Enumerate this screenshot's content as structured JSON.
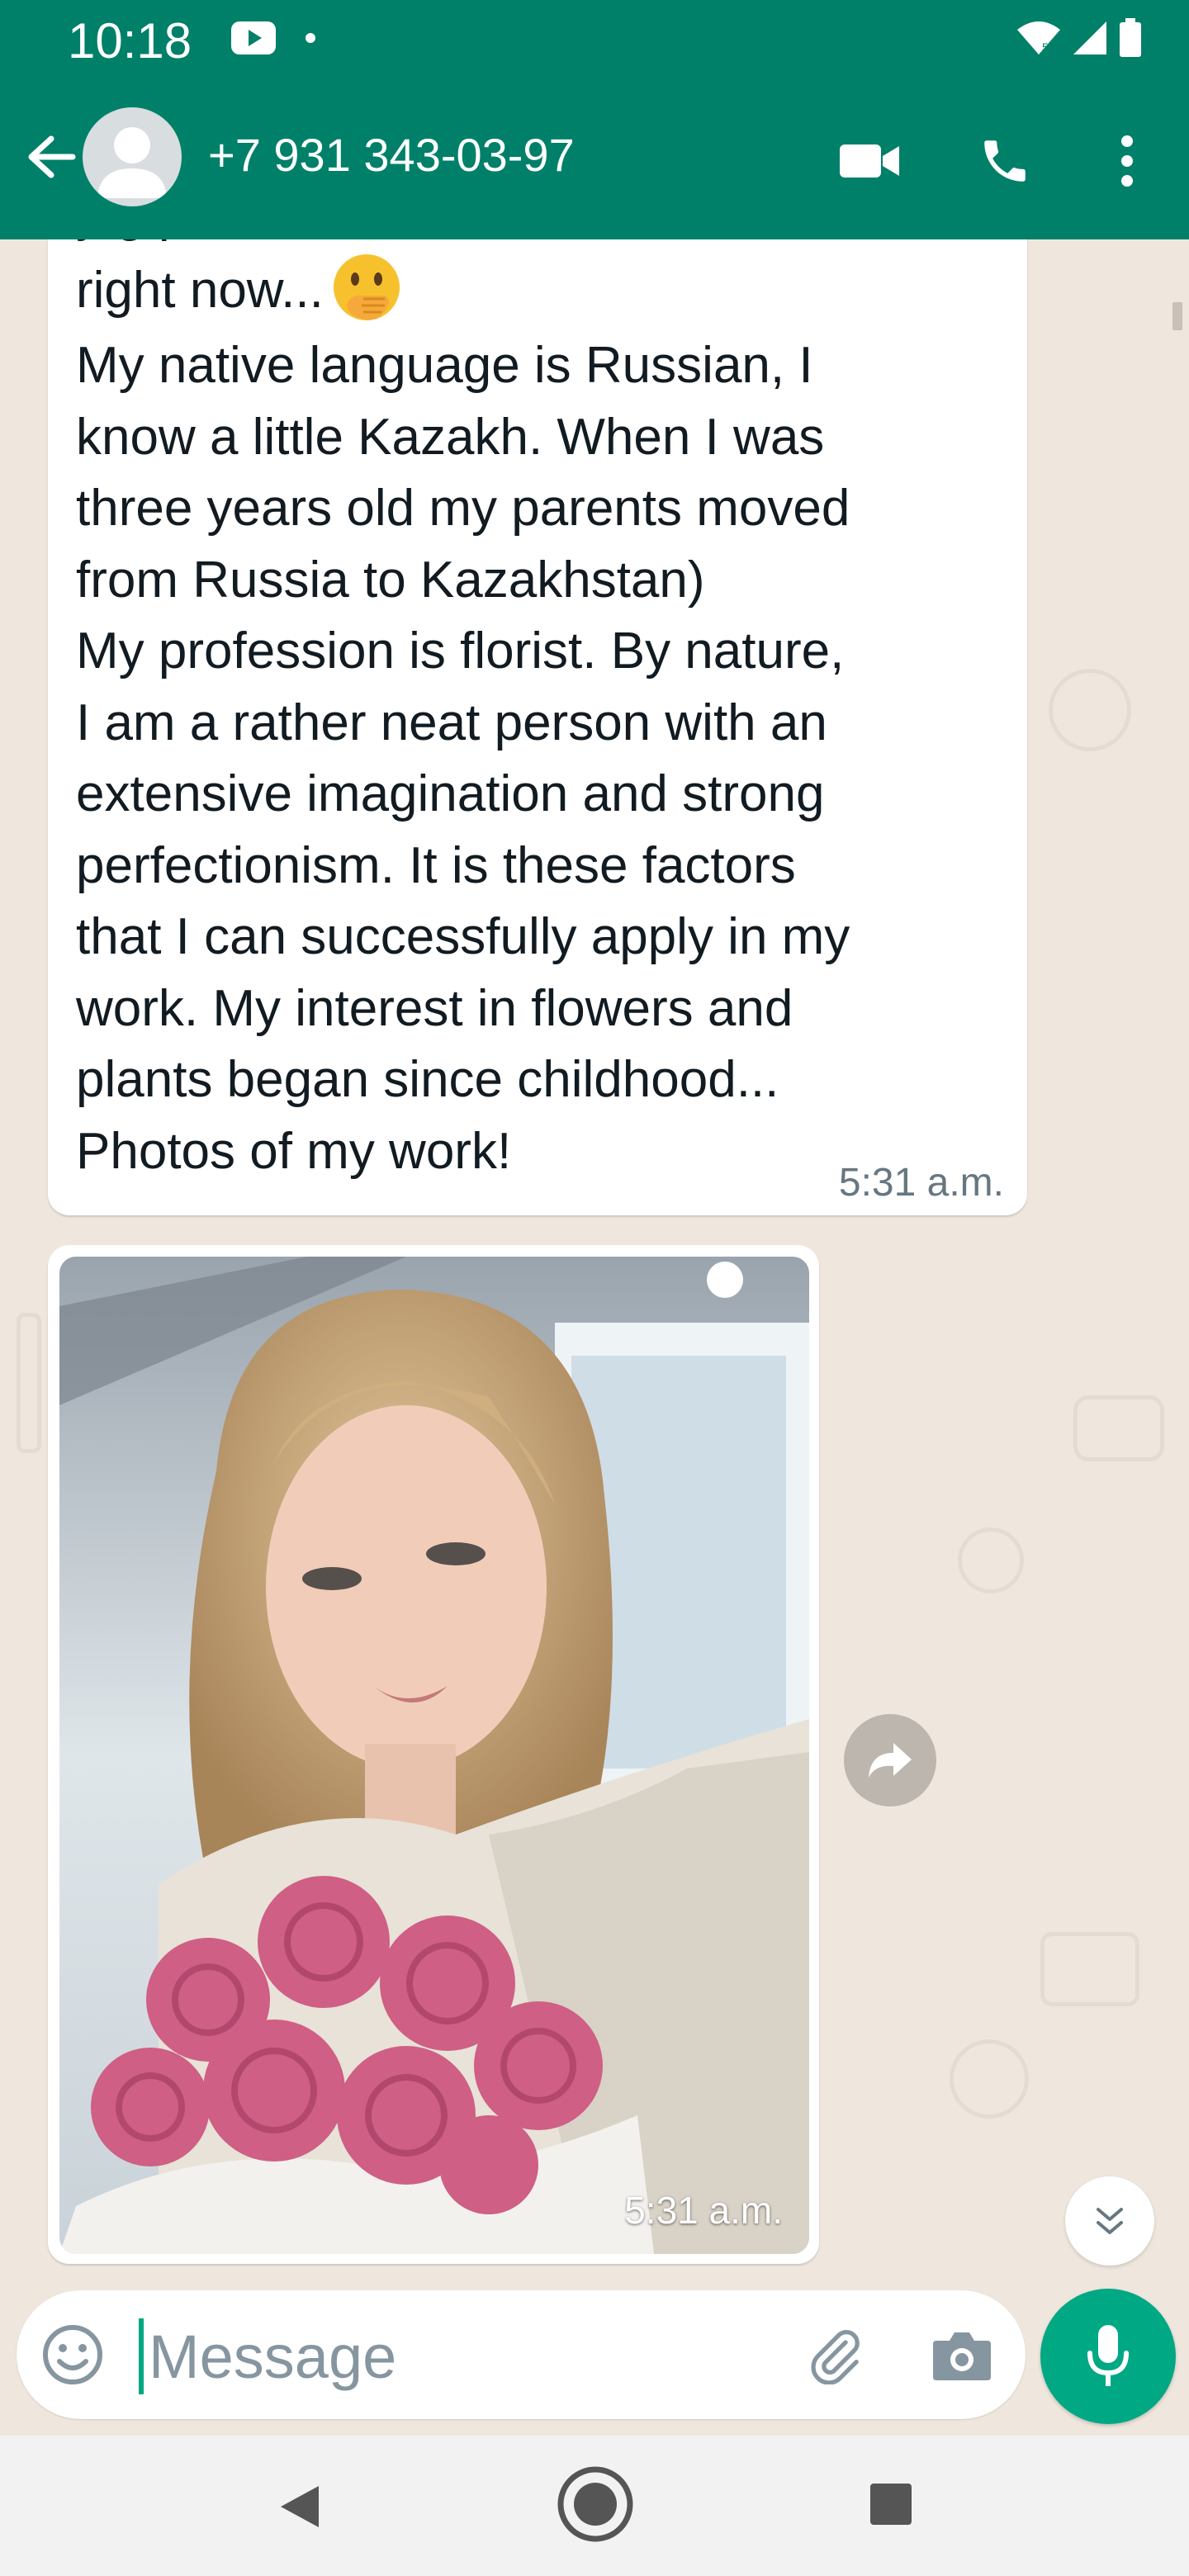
{
  "status_bar": {
    "time": "10:18"
  },
  "header": {
    "contact_name": "+7 931 343-03-97",
    "icons": [
      "back-arrow-icon",
      "avatar",
      "video-call-icon",
      "phone-icon",
      "more-vertical-icon"
    ]
  },
  "messages": [
    {
      "type": "text",
      "partial_top_line": "y          g          p",
      "text_first_line": "right now...",
      "emoji": "face-with-hand-over-mouth",
      "text_rest": "My native language is Russian, I\nknow a little Kazakh. When I was\nthree years old my parents moved\nfrom Russia to Kazakhstan)\nMy profession is florist. By nature,\nI am a rather neat person with an\nextensive imagination and strong\nperfectionism. It is these factors\nthat I can successfully apply in my\nwork. My interest in flowers and\nplants began since childhood...\nPhotos of my work!",
      "time": "5:31 a.m."
    },
    {
      "type": "image",
      "time": "5:31 a.m."
    }
  ],
  "input": {
    "placeholder": "Message"
  },
  "colors": {
    "header": "#008069",
    "accent": "#00a884",
    "chat_bg": "#efe7de"
  }
}
